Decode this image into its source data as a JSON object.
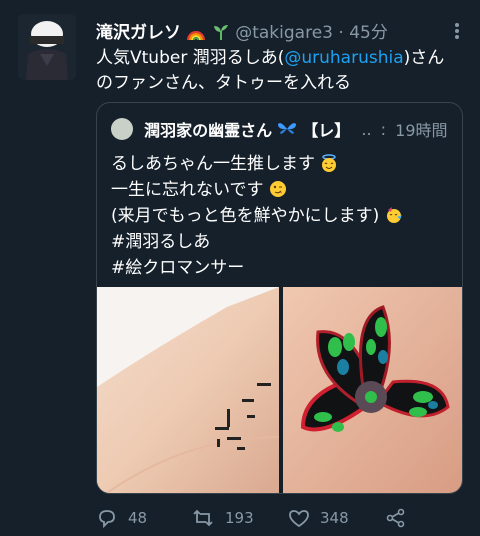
{
  "tweet": {
    "display_name": "滝沢ガレソ",
    "handle": "@takigare3",
    "separator": "·",
    "time": "45分",
    "text_before_mention": "人気Vtuber 潤羽るしあ(",
    "mention": "@uruharushia",
    "text_after_mention": ")さん",
    "text_line2": "のファンさん、タトゥーを入れる"
  },
  "quote": {
    "display_name": "潤羽家の幽霊さん",
    "bracket_label": "【レ】",
    "ellipsis": "..",
    "separator": ":",
    "time": "19時間",
    "lines": [
      "るしあちゃん一生推します",
      "一生に忘れないです",
      "(来月でもっと色を鮮やかにします)",
      "#潤羽るしあ",
      "#絵クロマンサー"
    ]
  },
  "actions": {
    "reply_count": "48",
    "retweet_count": "193",
    "like_count": "348"
  },
  "icons": {
    "reply": "reply-icon",
    "retweet": "retweet-icon",
    "like": "heart-icon",
    "share": "share-icon",
    "more": "more-vertical-icon"
  },
  "colors": {
    "background": "#15202b",
    "secondary_text": "#8899a6",
    "mention": "#1da1f2",
    "border": "#38444d",
    "butterfly_green": "#2fbf4a",
    "butterfly_teal": "#1a7fa0",
    "butterfly_black": "#101214",
    "butterfly_red": "#d02030"
  }
}
